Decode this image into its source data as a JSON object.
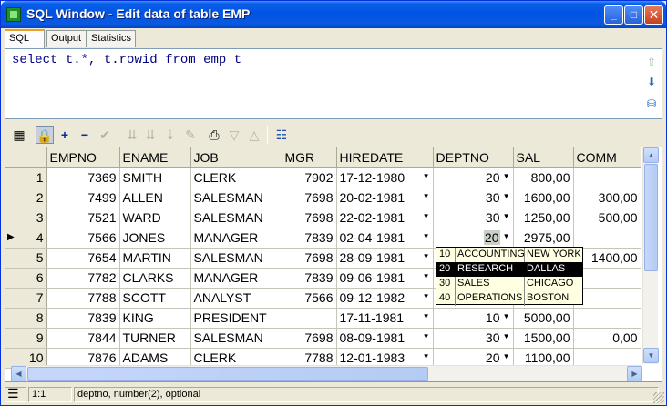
{
  "window": {
    "title": "SQL Window - Edit data of table EMP",
    "colors": {
      "titlebar": "#0054e3",
      "face": "#ece9d8"
    }
  },
  "tabs": [
    "SQL",
    "Output",
    "Statistics"
  ],
  "editor": {
    "sql_parts": [
      "select",
      "t.*, t.rowid",
      "from",
      "emp t"
    ]
  },
  "grid": {
    "columns": [
      "",
      "EMPNO",
      "ENAME",
      "JOB",
      "MGR",
      "HIREDATE",
      "DEPTNO",
      "SAL",
      "COMM"
    ],
    "rows": [
      [
        "1",
        "7369",
        "SMITH",
        "CLERK",
        "7902",
        "17-12-1980",
        "20",
        "800,00",
        ""
      ],
      [
        "2",
        "7499",
        "ALLEN",
        "SALESMAN",
        "7698",
        "20-02-1981",
        "30",
        "1600,00",
        "300,00"
      ],
      [
        "3",
        "7521",
        "WARD",
        "SALESMAN",
        "7698",
        "22-02-1981",
        "30",
        "1250,00",
        "500,00"
      ],
      [
        "4",
        "7566",
        "JONES",
        "MANAGER",
        "7839",
        "02-04-1981",
        "20",
        "2975,00",
        ""
      ],
      [
        "5",
        "7654",
        "MARTIN",
        "SALESMAN",
        "7698",
        "28-09-1981",
        "",
        "",
        "1400,00"
      ],
      [
        "6",
        "7782",
        "CLARKS",
        "MANAGER",
        "7839",
        "09-06-1981",
        "",
        "",
        ""
      ],
      [
        "7",
        "7788",
        "SCOTT",
        "ANALYST",
        "7566",
        "09-12-1982",
        "",
        "",
        ""
      ],
      [
        "8",
        "7839",
        "KING",
        "PRESIDENT",
        "",
        "17-11-1981",
        "10",
        "5000,00",
        ""
      ],
      [
        "9",
        "7844",
        "TURNER",
        "SALESMAN",
        "7698",
        "08-09-1981",
        "30",
        "1500,00",
        "0,00"
      ],
      [
        "10",
        "7876",
        "ADAMS",
        "CLERK",
        "7788",
        "12-01-1983",
        "20",
        "1100,00",
        ""
      ]
    ],
    "current_row": 4
  },
  "popup": {
    "rows": [
      [
        "10",
        "ACCOUNTING",
        "NEW YORK"
      ],
      [
        "20",
        "RESEARCH",
        "DALLAS"
      ],
      [
        "30",
        "SALES",
        "CHICAGO"
      ],
      [
        "40",
        "OPERATIONS",
        "BOSTON"
      ]
    ],
    "selected": 1
  },
  "status": {
    "position": "1:1",
    "field_info": "deptno, number(2), optional"
  }
}
